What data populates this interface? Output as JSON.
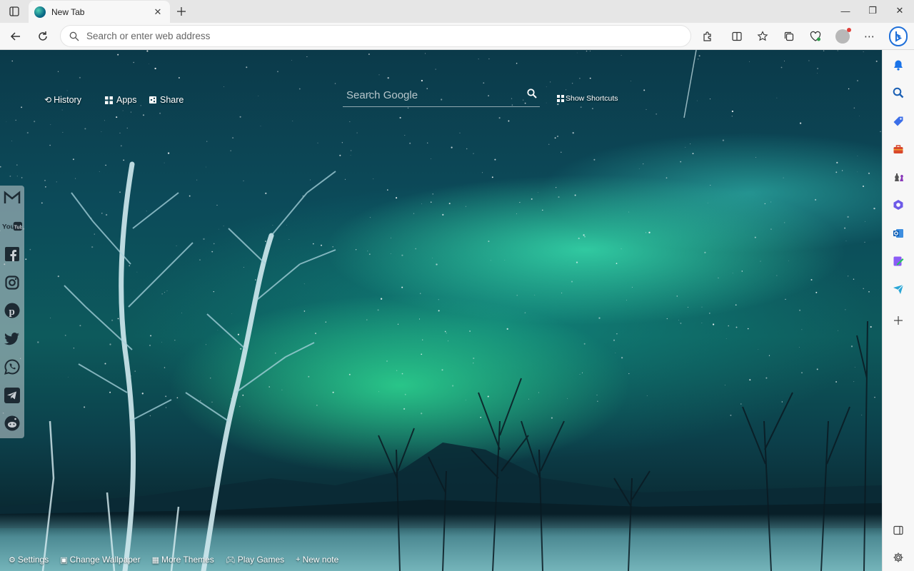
{
  "tab": {
    "title": "New Tab"
  },
  "window": {
    "minimize": "—",
    "restore": "❐",
    "close": "✕"
  },
  "address": {
    "placeholder": "Search or enter web address"
  },
  "newtab": {
    "nav": {
      "history": "History",
      "apps": "Apps",
      "share": "Share"
    },
    "search_placeholder": "Search Google",
    "show_shortcuts": "Show Shortcuts",
    "social": [
      "gmail",
      "youtube",
      "facebook",
      "instagram",
      "pinterest",
      "twitter",
      "whatsapp",
      "telegram",
      "reddit"
    ],
    "bottom": {
      "settings": "Settings",
      "change_wallpaper": "Change Wallpaper",
      "more_themes": "More Themes",
      "play_games": "Play Games",
      "new_note": "New note"
    }
  },
  "sidebar_icons": [
    "bell-icon",
    "search-icon",
    "tag-icon",
    "toolbox-icon",
    "chess-icon",
    "copilot-icon",
    "outlook-icon",
    "designer-icon",
    "send-icon",
    "add-icon"
  ],
  "colors": {
    "accent": "#0f6cbd",
    "sky": "#0b3a4a",
    "aurora": "#3cebb4"
  }
}
